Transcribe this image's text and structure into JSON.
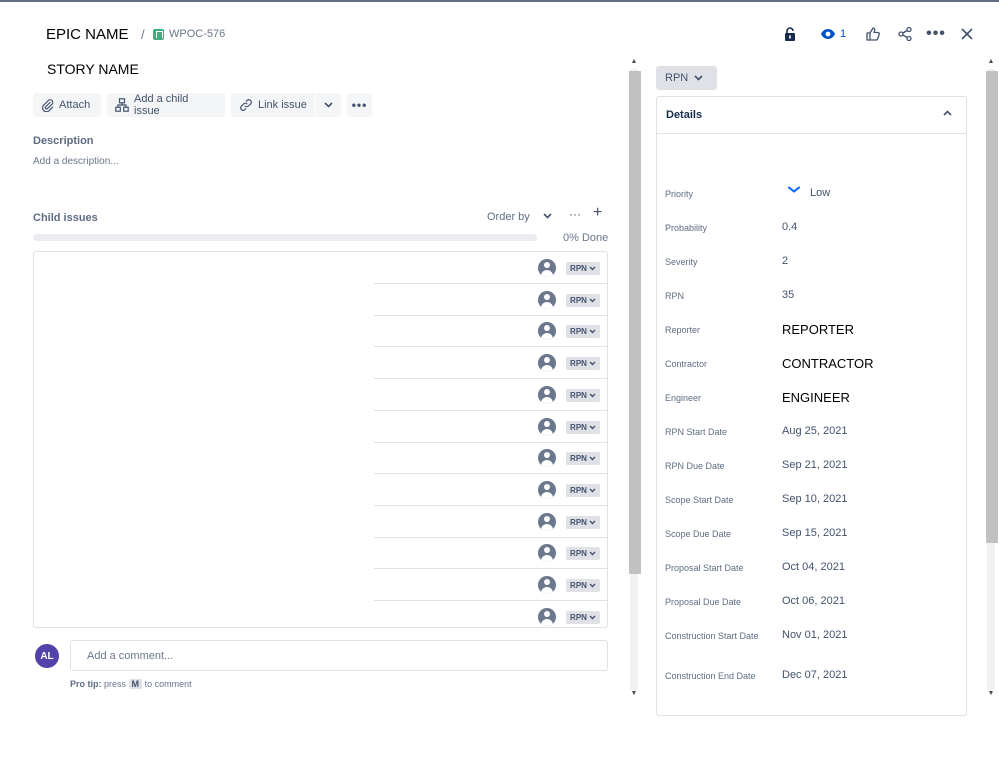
{
  "header": {
    "epic_name": "EPIC NAME",
    "separator": "/",
    "issue_key": "WPOC-576",
    "watch_count": "1"
  },
  "story_name": "STORY NAME",
  "toolbar": {
    "attach_label": "Attach",
    "add_child_label": "Add a child issue",
    "link_issue_label": "Link issue"
  },
  "description": {
    "title": "Description",
    "placeholder": "Add a description..."
  },
  "child_issues": {
    "title": "Child issues",
    "order_by_label": "Order by",
    "progress_fraction": 0.0,
    "progress_text": "0% Done",
    "rows": [
      {
        "status": "RPN"
      },
      {
        "status": "RPN"
      },
      {
        "status": "RPN"
      },
      {
        "status": "RPN"
      },
      {
        "status": "RPN"
      },
      {
        "status": "RPN"
      },
      {
        "status": "RPN"
      },
      {
        "status": "RPN"
      },
      {
        "status": "RPN"
      },
      {
        "status": "RPN"
      },
      {
        "status": "RPN"
      },
      {
        "status": "RPN"
      }
    ]
  },
  "comment": {
    "avatar_initials": "AL",
    "placeholder": "Add a comment...",
    "pro_tip_label": "Pro tip:",
    "pro_tip_press": "press",
    "pro_tip_key": "M",
    "pro_tip_suffix": "to comment"
  },
  "status_button": {
    "label": "RPN"
  },
  "details": {
    "title": "Details",
    "fields": [
      {
        "label": "Priority",
        "value": "Low"
      },
      {
        "label": "Probability",
        "value": "0.4"
      },
      {
        "label": "Severity",
        "value": "2"
      },
      {
        "label": "RPN",
        "value": "35"
      },
      {
        "label": "Reporter",
        "value": "REPORTER"
      },
      {
        "label": "Contractor",
        "value": "CONTRACTOR"
      },
      {
        "label": "Engineer",
        "value": "ENGINEER"
      },
      {
        "label": "RPN Start Date",
        "value": "Aug 25, 2021"
      },
      {
        "label": "RPN Due Date",
        "value": "Sep 21, 2021"
      },
      {
        "label": "Scope Start Date",
        "value": "Sep 10, 2021"
      },
      {
        "label": "Scope Due Date",
        "value": "Sep 15, 2021"
      },
      {
        "label": "Proposal Start Date",
        "value": "Oct 04, 2021"
      },
      {
        "label": "Proposal Due Date",
        "value": "Oct 06, 2021"
      },
      {
        "label": "Construction Start Date",
        "value": "Nov 01, 2021"
      },
      {
        "label": "Construction End Date",
        "value": "Dec 07, 2021"
      }
    ]
  },
  "colors": {
    "accent": "#0052cc",
    "story_icon": "#36b37e",
    "avatar": "#5243aa",
    "priority_low": "#0065ff"
  },
  "icons": [
    "story-icon",
    "lock-icon",
    "watch-eye-icon",
    "thumbs-up-icon",
    "share-icon",
    "more-icon",
    "close-icon",
    "paperclip-icon",
    "child-issue-icon",
    "link-icon",
    "chevron-down-icon",
    "plus-icon",
    "user-avatar-icon",
    "chevron-up-icon",
    "priority-low-icon"
  ]
}
